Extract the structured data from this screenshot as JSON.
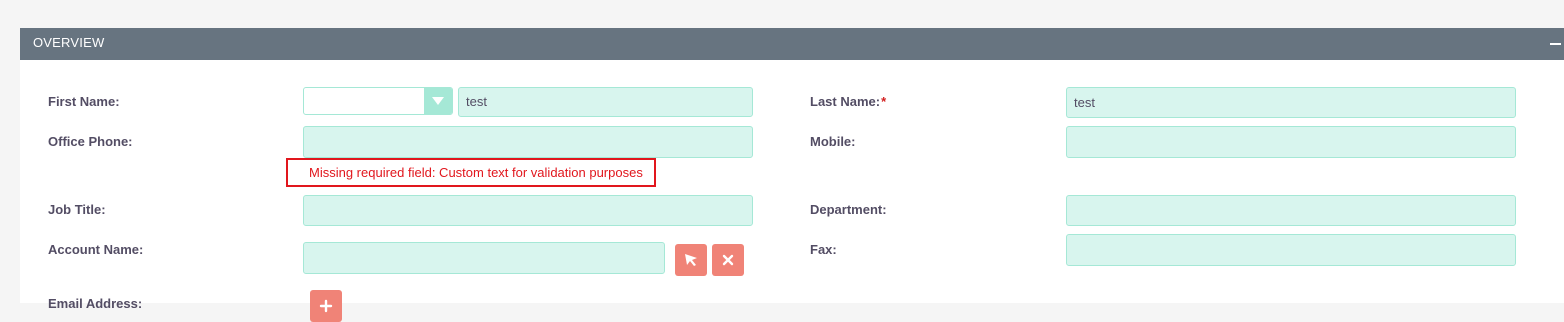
{
  "panel": {
    "title": "OVERVIEW",
    "collapse_icon": "minus-icon"
  },
  "fields": {
    "first_name": {
      "label": "First Name:",
      "salutation_value": "",
      "value": "test"
    },
    "last_name": {
      "label": "Last Name:",
      "required_marker": "*",
      "value": "test"
    },
    "office_phone": {
      "label": "Office Phone:",
      "value": ""
    },
    "mobile": {
      "label": "Mobile:",
      "value": ""
    },
    "job_title": {
      "label": "Job Title:",
      "value": ""
    },
    "department": {
      "label": "Department:",
      "value": ""
    },
    "account_name": {
      "label": "Account Name:",
      "value": "",
      "select_icon": "cursor-arrow-icon",
      "clear_icon": "close-icon"
    },
    "fax": {
      "label": "Fax:",
      "value": ""
    },
    "email": {
      "label": "Email Address:",
      "add_icon": "plus-icon"
    }
  },
  "validation": {
    "message": "Missing required field: Custom text for validation purposes"
  },
  "colors": {
    "header_bg": "#677480",
    "input_bg": "#d8f5ee",
    "input_border": "#a5e8d6",
    "button_bg": "#f08377",
    "error": "#e1161d"
  }
}
